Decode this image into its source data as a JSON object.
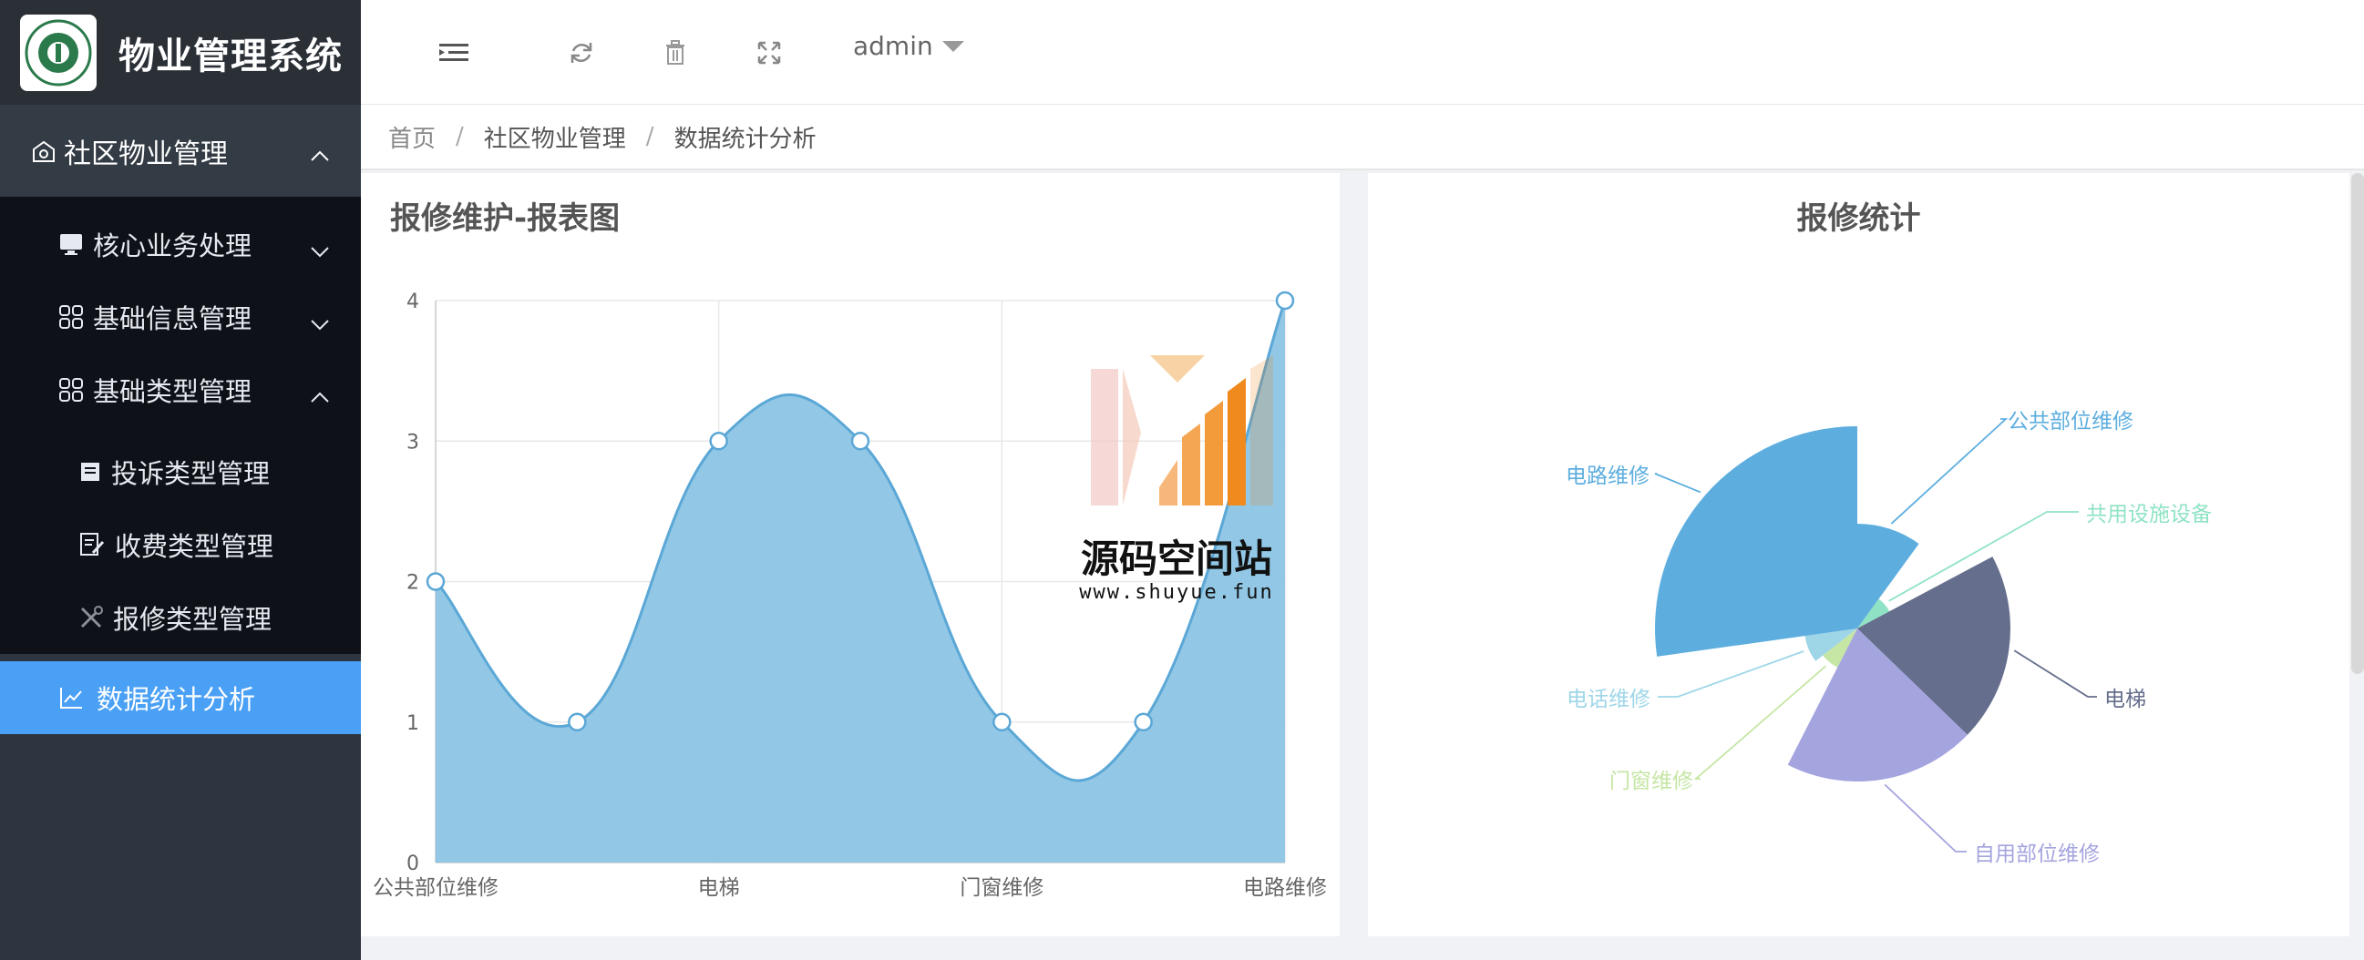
{
  "app": {
    "title": "物业管理系统"
  },
  "sidebar": {
    "top": {
      "label": "社区物业管理"
    },
    "items": [
      {
        "label": "核心业务处理"
      },
      {
        "label": "基础信息管理"
      },
      {
        "label": "基础类型管理"
      },
      {
        "label": "投诉类型管理"
      },
      {
        "label": "收费类型管理"
      },
      {
        "label": "报修类型管理"
      }
    ],
    "active": {
      "label": "数据统计分析"
    }
  },
  "header": {
    "user": "admin"
  },
  "breadcrumb": [
    "首页",
    "社区物业管理",
    "数据统计分析"
  ],
  "watermark": {
    "title": "源码空间站",
    "url": "www.shuyue.fun"
  },
  "chart_data": [
    {
      "type": "area",
      "title": "报修维护-报表图",
      "categories": [
        "公共部位维修",
        "",
        "电梯",
        "",
        "门窗维修",
        "",
        "电路维修"
      ],
      "values": [
        2,
        1,
        3,
        3,
        1,
        1,
        4
      ],
      "ylim": [
        0,
        4
      ],
      "yticks": [
        0,
        1,
        2,
        3,
        4
      ],
      "grid": true,
      "color": "#8cc5e5",
      "line_color": "#5ba7d6"
    },
    {
      "type": "pie",
      "title": "报修统计",
      "rose": true,
      "slices": [
        {
          "name": "公共部位维修",
          "color": "#5daedf"
        },
        {
          "name": "共用设施设备",
          "color": "#8fe3c4"
        },
        {
          "name": "电梯",
          "color": "#656e8c"
        },
        {
          "name": "自用部位维修",
          "color": "#a4a4df"
        },
        {
          "name": "门窗维修",
          "color": "#c5e6a4"
        },
        {
          "name": "电话维修",
          "color": "#9ed6e8"
        },
        {
          "name": "电路维修",
          "color": "#5daedf"
        }
      ]
    }
  ]
}
